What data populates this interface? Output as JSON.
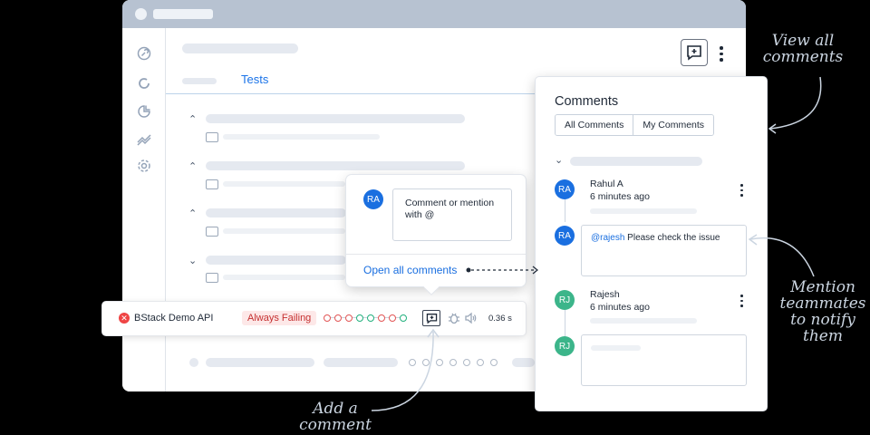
{
  "main": {
    "tab_active": "Tests"
  },
  "popup": {
    "avatar": "RA",
    "input_text": "Comment or mention with @",
    "link": "Open all comments"
  },
  "row": {
    "name": "BStack Demo API",
    "status": "Always Failing",
    "duration": "0.36 s",
    "history": [
      "fail",
      "fail",
      "fail",
      "pass",
      "pass",
      "fail",
      "fail",
      "pass"
    ]
  },
  "comments_panel": {
    "title": "Comments",
    "filters": [
      "All Comments",
      "My Comments"
    ],
    "comments": [
      {
        "avatar": "RA",
        "author": "Rahul A",
        "time": "6 minutes ago"
      },
      {
        "avatar": "RA",
        "mention": "@rajesh",
        "text": "Please check the issue"
      },
      {
        "avatar": "RJ",
        "author": "Rajesh",
        "time": "6 minutes ago"
      },
      {
        "avatar": "RJ"
      }
    ]
  },
  "annotations": {
    "view_all": "View all comments",
    "mention": "Mention teammates to notify them",
    "add": "Add a comment"
  },
  "colors": {
    "accent": "#1a73e8",
    "fail": "#e25555",
    "pass": "#22b07d",
    "avatar_blue": "#1a6fe0",
    "avatar_green": "#3cb58a"
  }
}
